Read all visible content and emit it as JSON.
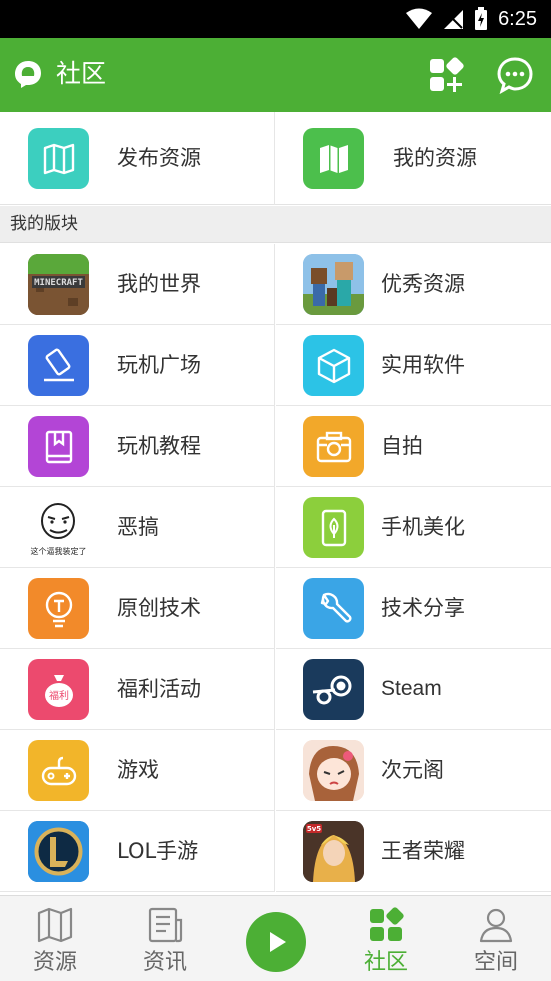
{
  "status_bar": {
    "time": "6:25"
  },
  "app_bar": {
    "title": "社区"
  },
  "quick_actions": [
    {
      "label": "发布资源",
      "icon": "map-icon",
      "color": "#3ccfbf"
    },
    {
      "label": "我的资源",
      "icon": "map-icon",
      "color": "#4cbf4c"
    }
  ],
  "section": {
    "title": "我的版块"
  },
  "boards": [
    {
      "label": "我的世界",
      "icon": "minecraft-icon"
    },
    {
      "label": "优秀资源",
      "icon": "minecraft-characters-icon"
    },
    {
      "label": "玩机广场",
      "icon": "eraser-icon",
      "color": "#3a6fe0"
    },
    {
      "label": "实用软件",
      "icon": "cube-icon",
      "color": "#2cc3e6"
    },
    {
      "label": "玩机教程",
      "icon": "book-icon",
      "color": "#b345d6"
    },
    {
      "label": "自拍",
      "icon": "camera-icon",
      "color": "#f2a82a"
    },
    {
      "label": "恶搞",
      "icon": "meme-face-icon",
      "caption": "这个逼我装定了"
    },
    {
      "label": "手机美化",
      "icon": "phone-leaf-icon",
      "color": "#8ccf3c"
    },
    {
      "label": "原创技术",
      "icon": "lightbulb-icon",
      "color": "#f28a2a"
    },
    {
      "label": "技术分享",
      "icon": "wrench-icon",
      "color": "#3aa5e6"
    },
    {
      "label": "福利活动",
      "icon": "gift-bag-icon",
      "color": "#ec4a6e",
      "badge": "福利"
    },
    {
      "label": "Steam",
      "icon": "steam-icon",
      "color": "#1a3a5c"
    },
    {
      "label": "游戏",
      "icon": "gamepad-icon",
      "color": "#f2b52a"
    },
    {
      "label": "次元阁",
      "icon": "anime-girl-icon"
    },
    {
      "label": "LOL手游",
      "icon": "lol-icon"
    },
    {
      "label": "王者荣耀",
      "icon": "honor-of-kings-icon",
      "badge": "5v5"
    }
  ],
  "bottom_nav": [
    {
      "label": "资源",
      "icon": "map-icon"
    },
    {
      "label": "资讯",
      "icon": "news-icon"
    },
    {
      "label": "社区",
      "icon": "grid-icon",
      "active": true
    },
    {
      "label": "空间",
      "icon": "user-icon"
    }
  ],
  "colors": {
    "primary": "#4caf35"
  }
}
